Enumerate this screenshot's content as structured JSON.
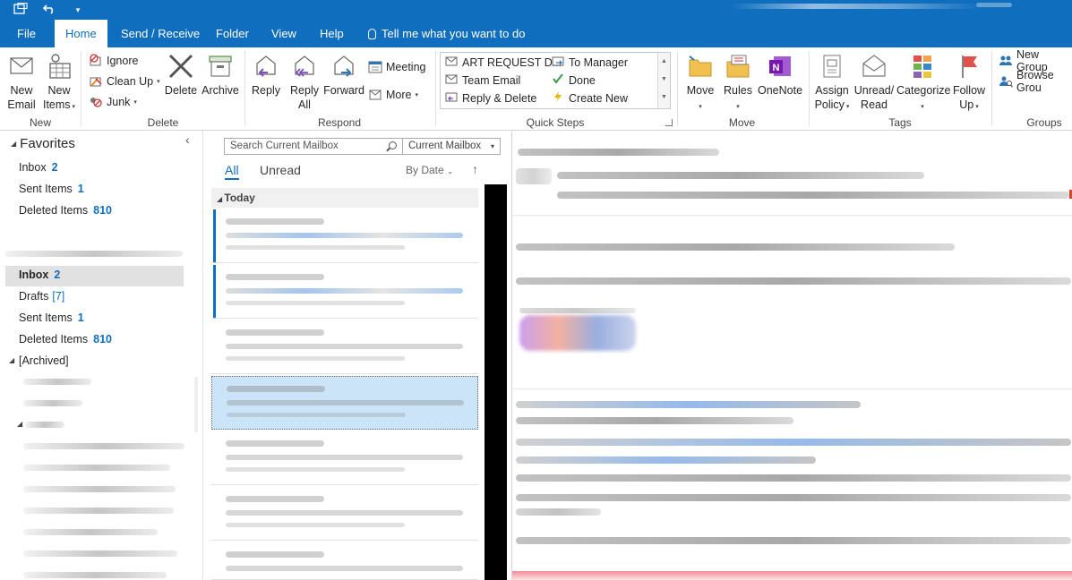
{
  "quick_access": {
    "undo_icon": "undo-icon",
    "customize_icon": "chevron-down-icon"
  },
  "tabs": [
    {
      "label": "File"
    },
    {
      "label": "Home"
    },
    {
      "label": "Send / Receive"
    },
    {
      "label": "Folder"
    },
    {
      "label": "View"
    },
    {
      "label": "Help"
    }
  ],
  "tell_me": "Tell me what you want to do",
  "ribbon": {
    "new": {
      "new_email": "New Email",
      "new_email_l1": "New",
      "new_email_l2": "Email",
      "new_items_l1": "New",
      "new_items_l2": "Items",
      "group_label": "New"
    },
    "delete": {
      "ignore": "Ignore",
      "clean_up": "Clean Up",
      "junk": "Junk",
      "delete": "Delete",
      "archive": "Archive",
      "group_label": "Delete"
    },
    "respond": {
      "reply": "Reply",
      "reply_all_l1": "Reply",
      "reply_all_l2": "All",
      "forward": "Forward",
      "meeting": "Meeting",
      "more": "More",
      "group_label": "Respond"
    },
    "quick_steps": {
      "items": [
        "ART REQUEST D...",
        "Team Email",
        "Reply & Delete",
        "To Manager",
        "Done",
        "Create New"
      ],
      "group_label": "Quick Steps"
    },
    "move": {
      "move": "Move",
      "rules": "Rules",
      "onenote": "OneNote",
      "group_label": "Move"
    },
    "tags": {
      "assign_policy_l1": "Assign",
      "assign_policy_l2": "Policy",
      "unread_read_l1": "Unread/",
      "unread_read_l2": "Read",
      "categorize": "Categorize",
      "follow_up_l1": "Follow",
      "follow_up_l2": "Up",
      "group_label": "Tags"
    },
    "groups": {
      "new_group": "New Group",
      "browse_groups": "Browse Grou",
      "group_label": "Groups"
    }
  },
  "folder_pane": {
    "favorites_title": "Favorites",
    "favorites": [
      {
        "name": "Inbox",
        "count": "2"
      },
      {
        "name": "Sent Items",
        "count": "1"
      },
      {
        "name": "Deleted Items",
        "count": "810"
      }
    ],
    "mailbox_folders": [
      {
        "name": "Inbox",
        "count": "2"
      },
      {
        "name": "Drafts",
        "count": "[7]"
      },
      {
        "name": "Sent Items",
        "count": "1"
      },
      {
        "name": "Deleted Items",
        "count": "810"
      },
      {
        "name": "[Archived]",
        "count": ""
      }
    ]
  },
  "message_list": {
    "search_placeholder": "Search Current Mailbox",
    "scope": "Current Mailbox",
    "filter_all": "All",
    "filter_unread": "Unread",
    "sort_by": "By Date",
    "group_today": "Today"
  },
  "colors": {
    "accent": "#106ebe",
    "selection": "#cce4f7",
    "ribbon_bg": "#ffffff"
  }
}
